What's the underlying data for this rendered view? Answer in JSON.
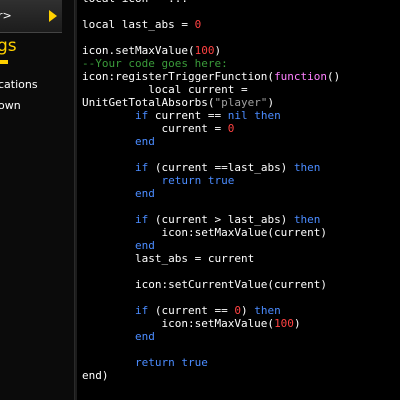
{
  "sidebar": {
    "top_label": "r>",
    "heading": "gs",
    "items": [
      {
        "label": "cations"
      },
      {
        "label": "own"
      }
    ]
  },
  "editor": {
    "lines": [
      [
        {
          "t": "local icon = ...",
          "c": "id"
        }
      ],
      [],
      [
        {
          "t": "local last_abs = ",
          "c": "id"
        },
        {
          "t": "0",
          "c": "num"
        }
      ],
      [],
      [
        {
          "t": "icon.setMaxValue(",
          "c": "id"
        },
        {
          "t": "100",
          "c": "num"
        },
        {
          "t": ")",
          "c": "id"
        }
      ],
      [
        {
          "t": "--Your code goes here:",
          "c": "cm"
        }
      ],
      [
        {
          "t": "icon:registerTriggerFunction(",
          "c": "id"
        },
        {
          "t": "function",
          "c": "fn"
        },
        {
          "t": "()",
          "c": "id"
        }
      ],
      [
        {
          "t": "          local current =",
          "c": "id"
        }
      ],
      [
        {
          "t": "UnitGetTotalAbsorbs(",
          "c": "id"
        },
        {
          "t": "\"player\"",
          "c": "str"
        },
        {
          "t": ")",
          "c": "id"
        }
      ],
      [
        {
          "t": "        ",
          "c": "id"
        },
        {
          "t": "if",
          "c": "kw"
        },
        {
          "t": " current == ",
          "c": "id"
        },
        {
          "t": "nil",
          "c": "kw"
        },
        {
          "t": " ",
          "c": "id"
        },
        {
          "t": "then",
          "c": "kw"
        }
      ],
      [
        {
          "t": "            current = ",
          "c": "id"
        },
        {
          "t": "0",
          "c": "num"
        }
      ],
      [
        {
          "t": "        ",
          "c": "id"
        },
        {
          "t": "end",
          "c": "kw"
        }
      ],
      [],
      [
        {
          "t": "        ",
          "c": "id"
        },
        {
          "t": "if",
          "c": "kw"
        },
        {
          "t": " (current ==last_abs) ",
          "c": "id"
        },
        {
          "t": "then",
          "c": "kw"
        }
      ],
      [
        {
          "t": "            ",
          "c": "id"
        },
        {
          "t": "return",
          "c": "kw"
        },
        {
          "t": " ",
          "c": "id"
        },
        {
          "t": "true",
          "c": "kw"
        }
      ],
      [
        {
          "t": "        ",
          "c": "id"
        },
        {
          "t": "end",
          "c": "kw"
        }
      ],
      [],
      [
        {
          "t": "        ",
          "c": "id"
        },
        {
          "t": "if",
          "c": "kw"
        },
        {
          "t": " (current > last_abs) ",
          "c": "id"
        },
        {
          "t": "then",
          "c": "kw"
        }
      ],
      [
        {
          "t": "            icon:setMaxValue(current)",
          "c": "id"
        }
      ],
      [
        {
          "t": "        ",
          "c": "id"
        },
        {
          "t": "end",
          "c": "kw"
        }
      ],
      [
        {
          "t": "        last_abs = current",
          "c": "id"
        }
      ],
      [],
      [
        {
          "t": "        icon:setCurrentValue(current)",
          "c": "id"
        }
      ],
      [],
      [
        {
          "t": "        ",
          "c": "id"
        },
        {
          "t": "if",
          "c": "kw"
        },
        {
          "t": " (current == ",
          "c": "id"
        },
        {
          "t": "0",
          "c": "num"
        },
        {
          "t": ") ",
          "c": "id"
        },
        {
          "t": "then",
          "c": "kw"
        }
      ],
      [
        {
          "t": "            icon:setMaxValue(",
          "c": "id"
        },
        {
          "t": "100",
          "c": "num"
        },
        {
          "t": ")",
          "c": "id"
        }
      ],
      [
        {
          "t": "        ",
          "c": "id"
        },
        {
          "t": "end",
          "c": "kw"
        }
      ],
      [],
      [
        {
          "t": "        ",
          "c": "id"
        },
        {
          "t": "return",
          "c": "kw"
        },
        {
          "t": " ",
          "c": "id"
        },
        {
          "t": "true",
          "c": "kw"
        }
      ],
      [
        {
          "t": "end)",
          "c": "id"
        }
      ]
    ]
  },
  "colors": {
    "keyword": "#4b8cff",
    "number": "#ff4242",
    "string": "#a0a0a0",
    "comment": "#3a9b3a",
    "function": "#ff80ff",
    "sidebar_heading": "#ffd100"
  }
}
